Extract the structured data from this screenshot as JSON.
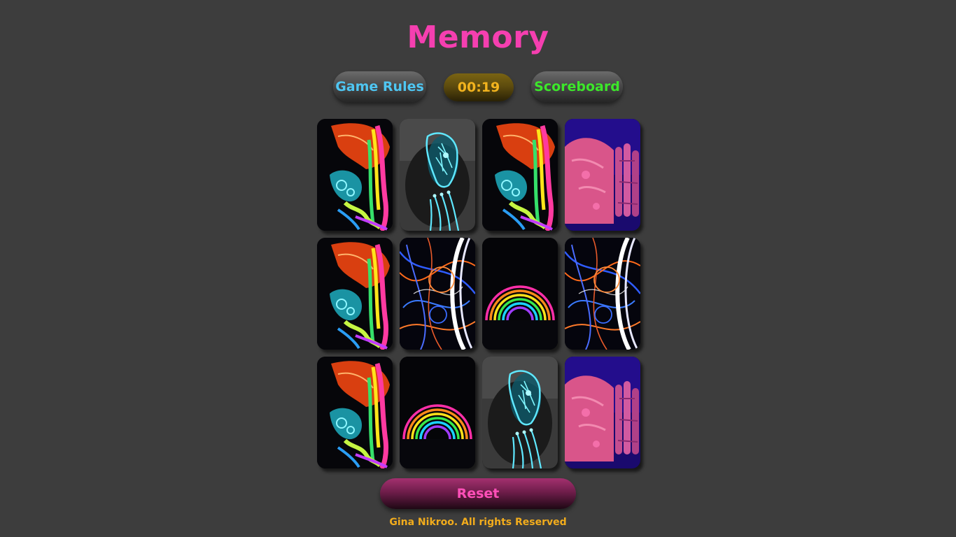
{
  "header": {
    "title": "Memory"
  },
  "controls": {
    "rules_label": "Game Rules",
    "timer": "00:19",
    "scoreboard_label": "Scoreboard",
    "reset_label": "Reset"
  },
  "board": {
    "rows": 3,
    "columns": 4,
    "cards": [
      "neon-skull-xray",
      "neon-face-portrait",
      "neon-skull-xray",
      "neon-pink-hand",
      "neon-skull-xray",
      "neon-light-streaks",
      "neon-rainbow",
      "neon-light-streaks",
      "neon-skull-xray",
      "neon-rainbow",
      "neon-face-portrait",
      "neon-pink-hand"
    ]
  },
  "footer": {
    "copyright": "Gina Nikroo. All rights Reserved"
  },
  "colors": {
    "background": "#3d3d3d",
    "title": "#f53fb0",
    "rules_text": "#4fc6f2",
    "timer_text": "#f2b31e",
    "scoreboard_text": "#3ce82a",
    "reset_text": "#ff4fb8",
    "footer_text": "#f2ac1c"
  }
}
